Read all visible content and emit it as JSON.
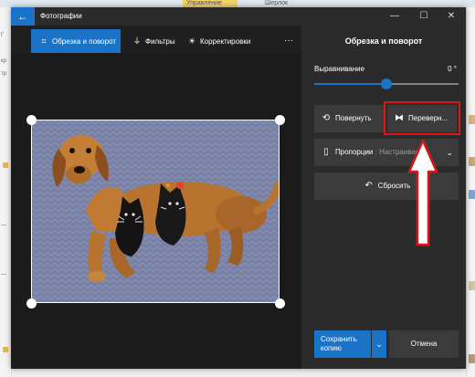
{
  "background": {
    "tabs": [
      "Управление",
      "Шерлок"
    ]
  },
  "window": {
    "title": "Фотографии",
    "back_icon": "arrow-left-icon",
    "accent_color": "#1a73c7"
  },
  "toolbar": {
    "crop": "Обрезка и поворот",
    "filters": "Фильтры",
    "adjust": "Корректировки",
    "more": "···"
  },
  "panel": {
    "title": "Обрезка и поворот",
    "straighten_label": "Выравнивание",
    "straighten_value": "0 °",
    "straighten_level": 0.5,
    "rotate": "Повернуть",
    "flip": "Переверн...",
    "aspect_label": "Пропорции",
    "aspect_value": "Настраиваем...",
    "reset": "Сбросить",
    "save_line1": "Сохранить",
    "save_line2": "копию",
    "cancel": "Отмена"
  },
  "annotation": {
    "highlight_color": "#e01515"
  }
}
